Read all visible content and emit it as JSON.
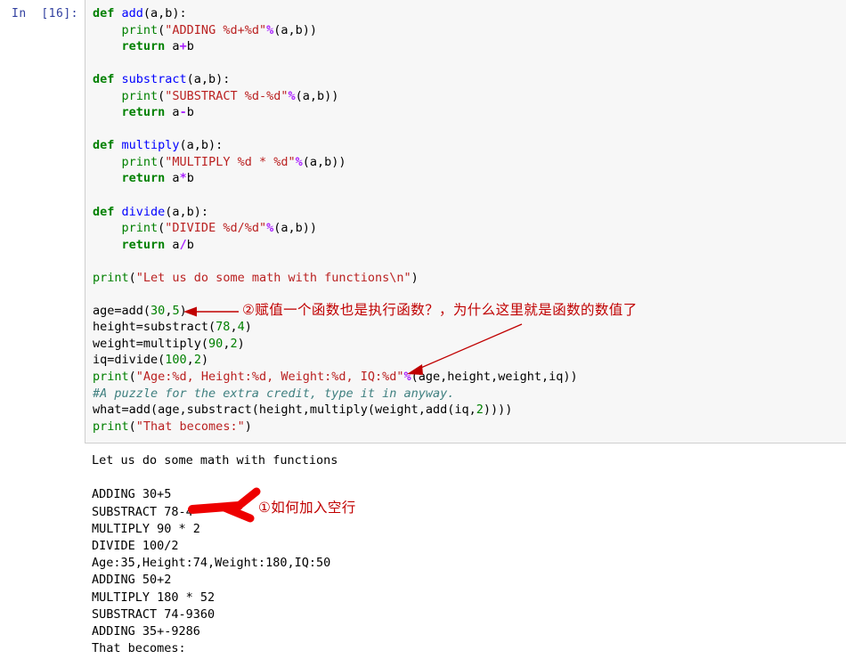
{
  "notebook": {
    "prompt_label": "In  [16]:",
    "code_lines": [
      [
        {
          "t": "def ",
          "c": "k"
        },
        {
          "t": "add",
          "c": "nf"
        },
        {
          "t": "(a,b):",
          "c": "n"
        }
      ],
      [
        {
          "t": "    ",
          "c": "n"
        },
        {
          "t": "print",
          "c": "nb"
        },
        {
          "t": "(",
          "c": "n"
        },
        {
          "t": "\"ADDING %d+%d\"",
          "c": "s"
        },
        {
          "t": "%",
          "c": "op"
        },
        {
          "t": "(a,b))",
          "c": "n"
        }
      ],
      [
        {
          "t": "    ",
          "c": "n"
        },
        {
          "t": "return",
          "c": "k"
        },
        {
          "t": " a",
          "c": "n"
        },
        {
          "t": "+",
          "c": "op"
        },
        {
          "t": "b",
          "c": "n"
        }
      ],
      [
        {
          "t": "",
          "c": "n"
        }
      ],
      [
        {
          "t": "def ",
          "c": "k"
        },
        {
          "t": "substract",
          "c": "nf"
        },
        {
          "t": "(a,b):",
          "c": "n"
        }
      ],
      [
        {
          "t": "    ",
          "c": "n"
        },
        {
          "t": "print",
          "c": "nb"
        },
        {
          "t": "(",
          "c": "n"
        },
        {
          "t": "\"SUBSTRACT %d-%d\"",
          "c": "s"
        },
        {
          "t": "%",
          "c": "op"
        },
        {
          "t": "(a,b))",
          "c": "n"
        }
      ],
      [
        {
          "t": "    ",
          "c": "n"
        },
        {
          "t": "return",
          "c": "k"
        },
        {
          "t": " a",
          "c": "n"
        },
        {
          "t": "-",
          "c": "op"
        },
        {
          "t": "b",
          "c": "n"
        }
      ],
      [
        {
          "t": "",
          "c": "n"
        }
      ],
      [
        {
          "t": "def ",
          "c": "k"
        },
        {
          "t": "multiply",
          "c": "nf"
        },
        {
          "t": "(a,b):",
          "c": "n"
        }
      ],
      [
        {
          "t": "    ",
          "c": "n"
        },
        {
          "t": "print",
          "c": "nb"
        },
        {
          "t": "(",
          "c": "n"
        },
        {
          "t": "\"MULTIPLY %d * %d\"",
          "c": "s"
        },
        {
          "t": "%",
          "c": "op"
        },
        {
          "t": "(a,b))",
          "c": "n"
        }
      ],
      [
        {
          "t": "    ",
          "c": "n"
        },
        {
          "t": "return",
          "c": "k"
        },
        {
          "t": " a",
          "c": "n"
        },
        {
          "t": "*",
          "c": "op"
        },
        {
          "t": "b",
          "c": "n"
        }
      ],
      [
        {
          "t": "",
          "c": "n"
        }
      ],
      [
        {
          "t": "def ",
          "c": "k"
        },
        {
          "t": "divide",
          "c": "nf"
        },
        {
          "t": "(a,b):",
          "c": "n"
        }
      ],
      [
        {
          "t": "    ",
          "c": "n"
        },
        {
          "t": "print",
          "c": "nb"
        },
        {
          "t": "(",
          "c": "n"
        },
        {
          "t": "\"DIVIDE %d/%d\"",
          "c": "s"
        },
        {
          "t": "%",
          "c": "op"
        },
        {
          "t": "(a,b))",
          "c": "n"
        }
      ],
      [
        {
          "t": "    ",
          "c": "n"
        },
        {
          "t": "return",
          "c": "k"
        },
        {
          "t": " a",
          "c": "n"
        },
        {
          "t": "/",
          "c": "op"
        },
        {
          "t": "b",
          "c": "n"
        }
      ],
      [
        {
          "t": "",
          "c": "n"
        }
      ],
      [
        {
          "t": "print",
          "c": "nb"
        },
        {
          "t": "(",
          "c": "n"
        },
        {
          "t": "\"Let us do some math with functions\\n\"",
          "c": "s"
        },
        {
          "t": ")",
          "c": "n"
        }
      ],
      [
        {
          "t": "",
          "c": "n"
        }
      ],
      [
        {
          "t": "age=",
          "c": "n"
        },
        {
          "t": "add",
          "c": "n"
        },
        {
          "t": "(",
          "c": "n"
        },
        {
          "t": "30",
          "c": "mi"
        },
        {
          "t": ",",
          "c": "n"
        },
        {
          "t": "5",
          "c": "mi"
        },
        {
          "t": ")",
          "c": "n"
        }
      ],
      [
        {
          "t": "height=substract(",
          "c": "n"
        },
        {
          "t": "78",
          "c": "mi"
        },
        {
          "t": ",",
          "c": "n"
        },
        {
          "t": "4",
          "c": "mi"
        },
        {
          "t": ")",
          "c": "n"
        }
      ],
      [
        {
          "t": "weight=multiply(",
          "c": "n"
        },
        {
          "t": "90",
          "c": "mi"
        },
        {
          "t": ",",
          "c": "n"
        },
        {
          "t": "2",
          "c": "mi"
        },
        {
          "t": ")",
          "c": "n"
        }
      ],
      [
        {
          "t": "iq=divide(",
          "c": "n"
        },
        {
          "t": "100",
          "c": "mi"
        },
        {
          "t": ",",
          "c": "n"
        },
        {
          "t": "2",
          "c": "mi"
        },
        {
          "t": ")",
          "c": "n"
        }
      ],
      [
        {
          "t": "print",
          "c": "nb"
        },
        {
          "t": "(",
          "c": "n"
        },
        {
          "t": "\"Age:%d, Height:%d, Weight:%d, IQ:%d\"",
          "c": "s"
        },
        {
          "t": "%",
          "c": "op"
        },
        {
          "t": "(age,height,weight,iq))",
          "c": "n"
        }
      ],
      [
        {
          "t": "#A puzzle for the extra credit, type it in anyway.",
          "c": "c"
        }
      ],
      [
        {
          "t": "what=add(age,substract(height,multiply(weight,add(iq,",
          "c": "n"
        },
        {
          "t": "2",
          "c": "mi"
        },
        {
          "t": "))))",
          "c": "n"
        }
      ],
      [
        {
          "t": "print",
          "c": "nb"
        },
        {
          "t": "(",
          "c": "n"
        },
        {
          "t": "\"That becomes:\"",
          "c": "s"
        },
        {
          "t": ")",
          "c": "n"
        }
      ]
    ],
    "output_lines": [
      "Let us do some math with functions",
      "",
      "ADDING 30+5",
      "SUBSTRACT 78-4",
      "MULTIPLY 90 * 2",
      "DIVIDE 100/2",
      "Age:35,Height:74,Weight:180,IQ:50",
      "ADDING 50+2",
      "MULTIPLY 180 * 52",
      "SUBSTRACT 74-9360",
      "ADDING 35+-9286",
      "That becomes:"
    ]
  },
  "annotations": {
    "note_1": "①如何加入空行",
    "note_2": "②赋值一个函数也是执行函数？，为什么这里就是函数的数值了"
  },
  "colors": {
    "annotation_text": "#C00000",
    "thin_arrow": "#C00000",
    "thick_arrow": "#EE0000",
    "cell_background": "#F7F7F7",
    "cell_border": "#CFCFCF",
    "prompt": "#303F9F",
    "keyword": "#008000",
    "function_name": "#0000FF",
    "string": "#BA2121",
    "number": "#008000",
    "comment": "#408080",
    "percent_operator": "#AA22FF"
  }
}
